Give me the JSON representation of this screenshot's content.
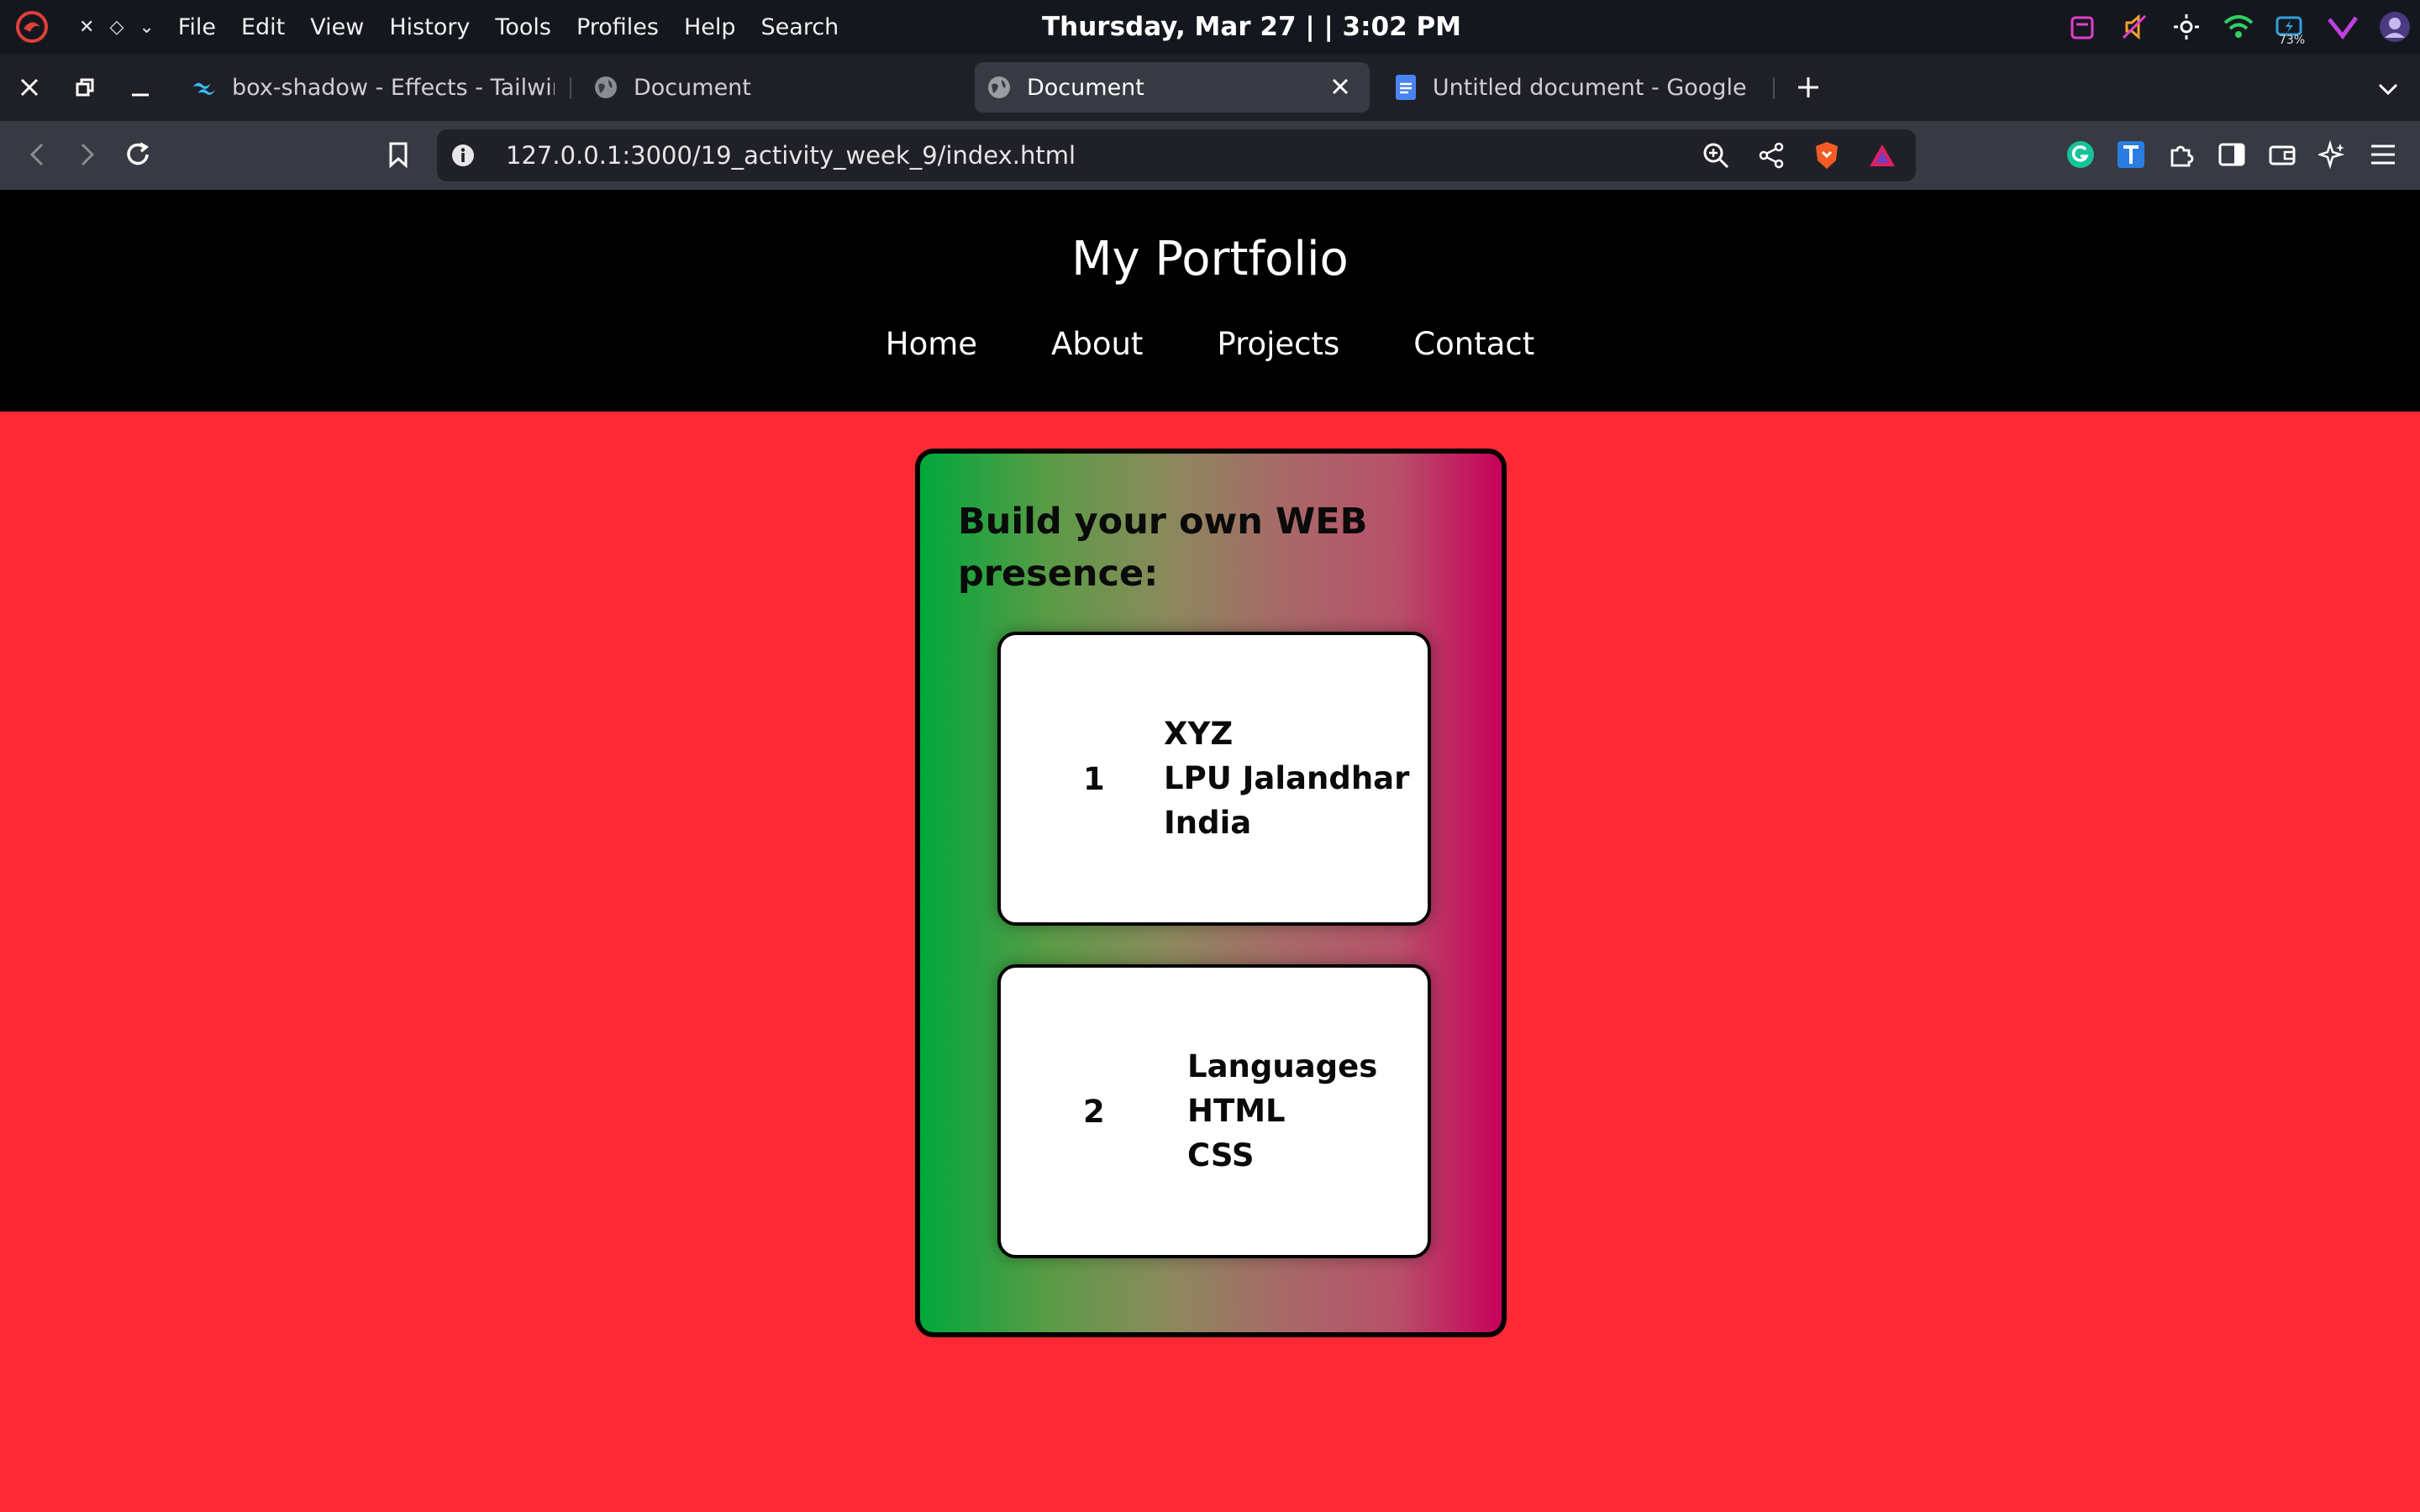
{
  "system": {
    "menu": [
      "File",
      "Edit",
      "View",
      "History",
      "Tools",
      "Profiles",
      "Help",
      "Search"
    ],
    "clock": "Thursday, Mar 27 | | 3:02 PM",
    "battery_percent": "73%"
  },
  "tabs": [
    {
      "title": "box-shadow - Effects - Tailwind",
      "icon": "tailwind-icon"
    },
    {
      "title": "Document",
      "icon": "globe-icon"
    },
    {
      "title": "Document",
      "icon": "globe-icon",
      "active": true
    },
    {
      "title": "Untitled document - Google Do",
      "icon": "google-docs-icon"
    }
  ],
  "address": {
    "url": "127.0.0.1:3000/19_activity_week_9/index.html"
  },
  "site": {
    "title": "My Portfolio",
    "nav": [
      "Home",
      "About",
      "Projects",
      "Contact"
    ],
    "card": {
      "heading": "Build your own WEB presence:",
      "items": [
        {
          "num": "1",
          "lines": [
            "XYZ",
            "LPU Jalandhar",
            "India"
          ]
        },
        {
          "num": "2",
          "lines": [
            "Languages",
            "HTML",
            "CSS"
          ]
        }
      ]
    }
  },
  "colors": {
    "page_bg": "#ff2a36",
    "header_bg": "#000000",
    "gradient_start": "#00a83c",
    "gradient_end": "#c8005a"
  }
}
